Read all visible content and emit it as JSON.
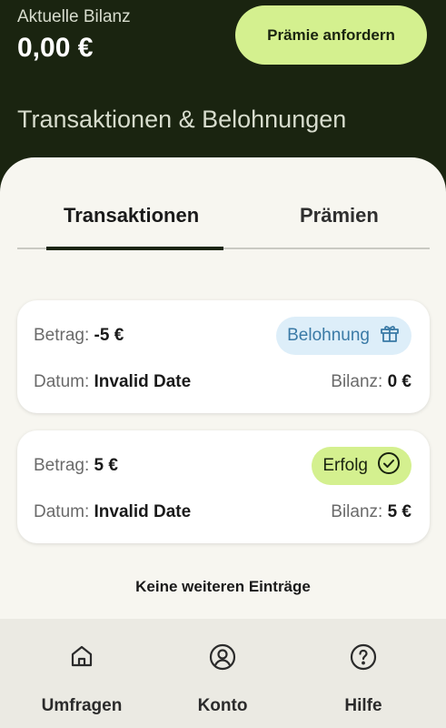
{
  "header": {
    "balance_label": "Aktuelle Bilanz",
    "balance_value": "0,00 €",
    "request_button": "Prämie anfordern",
    "section_title": "Transaktionen & Belohnungen"
  },
  "tabs": [
    {
      "label": "Transaktionen",
      "active": true
    },
    {
      "label": "Prämien",
      "active": false
    }
  ],
  "transactions": [
    {
      "amount_label": "Betrag:",
      "amount": "-5 €",
      "date_label": "Datum:",
      "date": "Invalid Date",
      "balance_label": "Bilanz:",
      "balance": "0 €",
      "badge": "Belohnung",
      "badge_icon": "gift-icon"
    },
    {
      "amount_label": "Betrag:",
      "amount": "5 €",
      "date_label": "Datum:",
      "date": "Invalid Date",
      "balance_label": "Bilanz:",
      "balance": "5 €",
      "badge": "Erfolg",
      "badge_icon": "check-circle-icon"
    }
  ],
  "end_text": "Keine weiteren Einträge",
  "bottom_nav": [
    {
      "label": "Umfragen",
      "icon": "home-icon"
    },
    {
      "label": "Konto",
      "icon": "account-icon"
    },
    {
      "label": "Hilfe",
      "icon": "help-icon"
    }
  ],
  "colors": {
    "header_bg": "#1a2410",
    "accent_green": "#d4f08f",
    "reward_badge_bg": "#ddeef9",
    "reward_badge_text": "#3a7aa6",
    "sheet_bg": "#f7f6f0",
    "nav_bg": "#ebeae3"
  }
}
